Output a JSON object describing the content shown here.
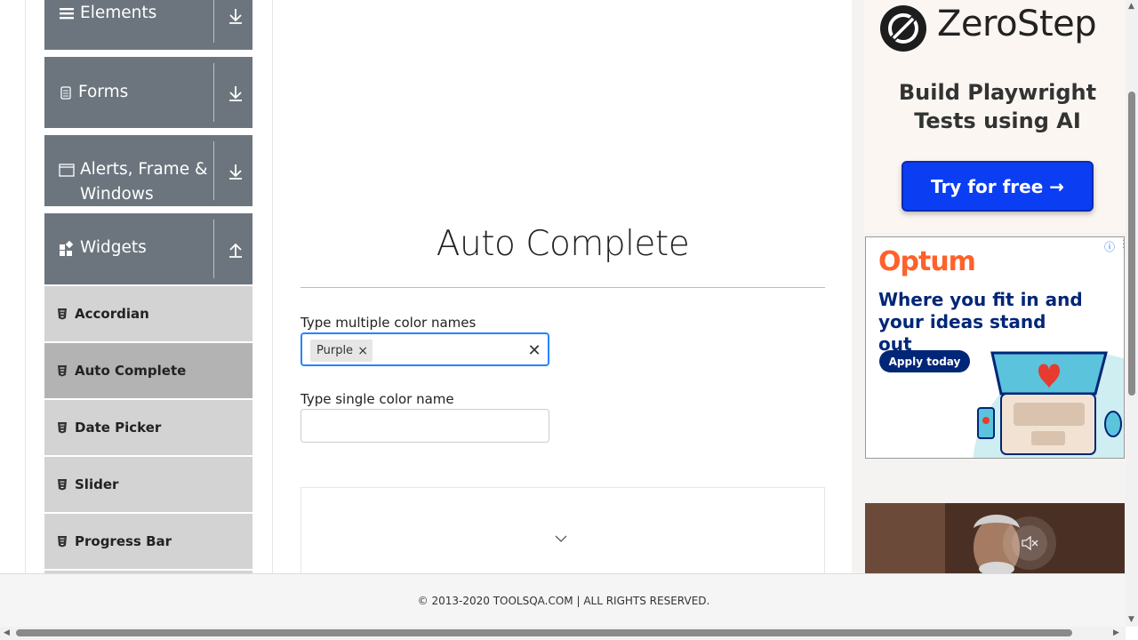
{
  "sidebar": {
    "groups": [
      {
        "label": "Elements",
        "icon": "menu-icon",
        "arrow": "download-arrow-icon"
      },
      {
        "label": "Forms",
        "icon": "document-icon",
        "arrow": "download-arrow-icon"
      },
      {
        "label": "Alerts, Frame & Windows",
        "label_line1": "Alerts, Frame &",
        "label_line2": "Windows",
        "icon": "window-icon",
        "arrow": "download-arrow-icon"
      },
      {
        "label": "Widgets",
        "icon": "widgets-icon",
        "arrow": "upload-arrow-icon"
      }
    ],
    "items": [
      {
        "label": "Accordian",
        "active": false
      },
      {
        "label": "Auto Complete",
        "active": true
      },
      {
        "label": "Date Picker",
        "active": false
      },
      {
        "label": "Slider",
        "active": false
      },
      {
        "label": "Progress Bar",
        "active": false
      }
    ]
  },
  "main": {
    "title": "Auto Complete",
    "multi": {
      "label": "Type multiple color names",
      "chips": [
        "Purple"
      ],
      "remove_glyph": "×",
      "clear_glyph": "✕"
    },
    "single": {
      "label": "Type single color name",
      "value": ""
    }
  },
  "ads": {
    "zerostep": {
      "brand": "ZeroStep",
      "tagline_line1": "Build Playwright",
      "tagline_line2": "Tests using AI",
      "cta": "Try for free →"
    },
    "optum": {
      "brand": "Optum",
      "headline": "Where you fit in and your ideas stand out",
      "cta": "Apply today",
      "info_glyph": "ⓘ",
      "menu_glyph": "⋮"
    }
  },
  "footer": {
    "text": "© 2013-2020 TOOLSQA.COM | ALL RIGHTS RESERVED."
  },
  "colors": {
    "sidebar_group": "#6c757d",
    "sidebar_item": "#d3d3d3",
    "sidebar_item_active": "#b3b3b3",
    "focus_border": "#2684ff",
    "zerostep_button": "#0b3ef2",
    "optum_orange": "#ff612b",
    "optum_navy": "#002677"
  }
}
